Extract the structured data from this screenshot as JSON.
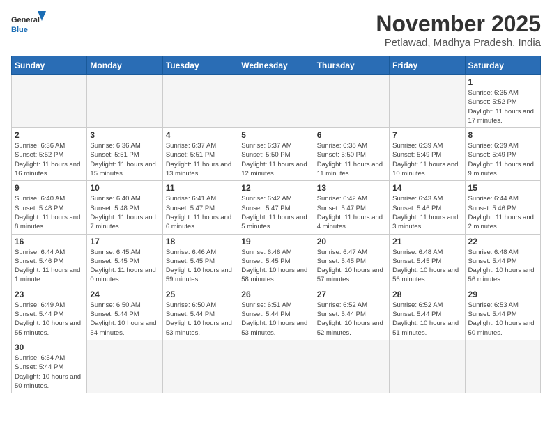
{
  "logo": {
    "text_general": "General",
    "text_blue": "Blue"
  },
  "header": {
    "month_year": "November 2025",
    "location": "Petlawad, Madhya Pradesh, India"
  },
  "weekdays": [
    "Sunday",
    "Monday",
    "Tuesday",
    "Wednesday",
    "Thursday",
    "Friday",
    "Saturday"
  ],
  "weeks": [
    [
      {
        "day": "",
        "info": ""
      },
      {
        "day": "",
        "info": ""
      },
      {
        "day": "",
        "info": ""
      },
      {
        "day": "",
        "info": ""
      },
      {
        "day": "",
        "info": ""
      },
      {
        "day": "",
        "info": ""
      },
      {
        "day": "1",
        "info": "Sunrise: 6:35 AM\nSunset: 5:52 PM\nDaylight: 11 hours and 17 minutes."
      }
    ],
    [
      {
        "day": "2",
        "info": "Sunrise: 6:36 AM\nSunset: 5:52 PM\nDaylight: 11 hours and 16 minutes."
      },
      {
        "day": "3",
        "info": "Sunrise: 6:36 AM\nSunset: 5:51 PM\nDaylight: 11 hours and 15 minutes."
      },
      {
        "day": "4",
        "info": "Sunrise: 6:37 AM\nSunset: 5:51 PM\nDaylight: 11 hours and 13 minutes."
      },
      {
        "day": "5",
        "info": "Sunrise: 6:37 AM\nSunset: 5:50 PM\nDaylight: 11 hours and 12 minutes."
      },
      {
        "day": "6",
        "info": "Sunrise: 6:38 AM\nSunset: 5:50 PM\nDaylight: 11 hours and 11 minutes."
      },
      {
        "day": "7",
        "info": "Sunrise: 6:39 AM\nSunset: 5:49 PM\nDaylight: 11 hours and 10 minutes."
      },
      {
        "day": "8",
        "info": "Sunrise: 6:39 AM\nSunset: 5:49 PM\nDaylight: 11 hours and 9 minutes."
      }
    ],
    [
      {
        "day": "9",
        "info": "Sunrise: 6:40 AM\nSunset: 5:48 PM\nDaylight: 11 hours and 8 minutes."
      },
      {
        "day": "10",
        "info": "Sunrise: 6:40 AM\nSunset: 5:48 PM\nDaylight: 11 hours and 7 minutes."
      },
      {
        "day": "11",
        "info": "Sunrise: 6:41 AM\nSunset: 5:47 PM\nDaylight: 11 hours and 6 minutes."
      },
      {
        "day": "12",
        "info": "Sunrise: 6:42 AM\nSunset: 5:47 PM\nDaylight: 11 hours and 5 minutes."
      },
      {
        "day": "13",
        "info": "Sunrise: 6:42 AM\nSunset: 5:47 PM\nDaylight: 11 hours and 4 minutes."
      },
      {
        "day": "14",
        "info": "Sunrise: 6:43 AM\nSunset: 5:46 PM\nDaylight: 11 hours and 3 minutes."
      },
      {
        "day": "15",
        "info": "Sunrise: 6:44 AM\nSunset: 5:46 PM\nDaylight: 11 hours and 2 minutes."
      }
    ],
    [
      {
        "day": "16",
        "info": "Sunrise: 6:44 AM\nSunset: 5:46 PM\nDaylight: 11 hours and 1 minute."
      },
      {
        "day": "17",
        "info": "Sunrise: 6:45 AM\nSunset: 5:45 PM\nDaylight: 11 hours and 0 minutes."
      },
      {
        "day": "18",
        "info": "Sunrise: 6:46 AM\nSunset: 5:45 PM\nDaylight: 10 hours and 59 minutes."
      },
      {
        "day": "19",
        "info": "Sunrise: 6:46 AM\nSunset: 5:45 PM\nDaylight: 10 hours and 58 minutes."
      },
      {
        "day": "20",
        "info": "Sunrise: 6:47 AM\nSunset: 5:45 PM\nDaylight: 10 hours and 57 minutes."
      },
      {
        "day": "21",
        "info": "Sunrise: 6:48 AM\nSunset: 5:45 PM\nDaylight: 10 hours and 56 minutes."
      },
      {
        "day": "22",
        "info": "Sunrise: 6:48 AM\nSunset: 5:44 PM\nDaylight: 10 hours and 56 minutes."
      }
    ],
    [
      {
        "day": "23",
        "info": "Sunrise: 6:49 AM\nSunset: 5:44 PM\nDaylight: 10 hours and 55 minutes."
      },
      {
        "day": "24",
        "info": "Sunrise: 6:50 AM\nSunset: 5:44 PM\nDaylight: 10 hours and 54 minutes."
      },
      {
        "day": "25",
        "info": "Sunrise: 6:50 AM\nSunset: 5:44 PM\nDaylight: 10 hours and 53 minutes."
      },
      {
        "day": "26",
        "info": "Sunrise: 6:51 AM\nSunset: 5:44 PM\nDaylight: 10 hours and 53 minutes."
      },
      {
        "day": "27",
        "info": "Sunrise: 6:52 AM\nSunset: 5:44 PM\nDaylight: 10 hours and 52 minutes."
      },
      {
        "day": "28",
        "info": "Sunrise: 6:52 AM\nSunset: 5:44 PM\nDaylight: 10 hours and 51 minutes."
      },
      {
        "day": "29",
        "info": "Sunrise: 6:53 AM\nSunset: 5:44 PM\nDaylight: 10 hours and 50 minutes."
      }
    ],
    [
      {
        "day": "30",
        "info": "Sunrise: 6:54 AM\nSunset: 5:44 PM\nDaylight: 10 hours and 50 minutes."
      },
      {
        "day": "",
        "info": ""
      },
      {
        "day": "",
        "info": ""
      },
      {
        "day": "",
        "info": ""
      },
      {
        "day": "",
        "info": ""
      },
      {
        "day": "",
        "info": ""
      },
      {
        "day": "",
        "info": ""
      }
    ]
  ]
}
